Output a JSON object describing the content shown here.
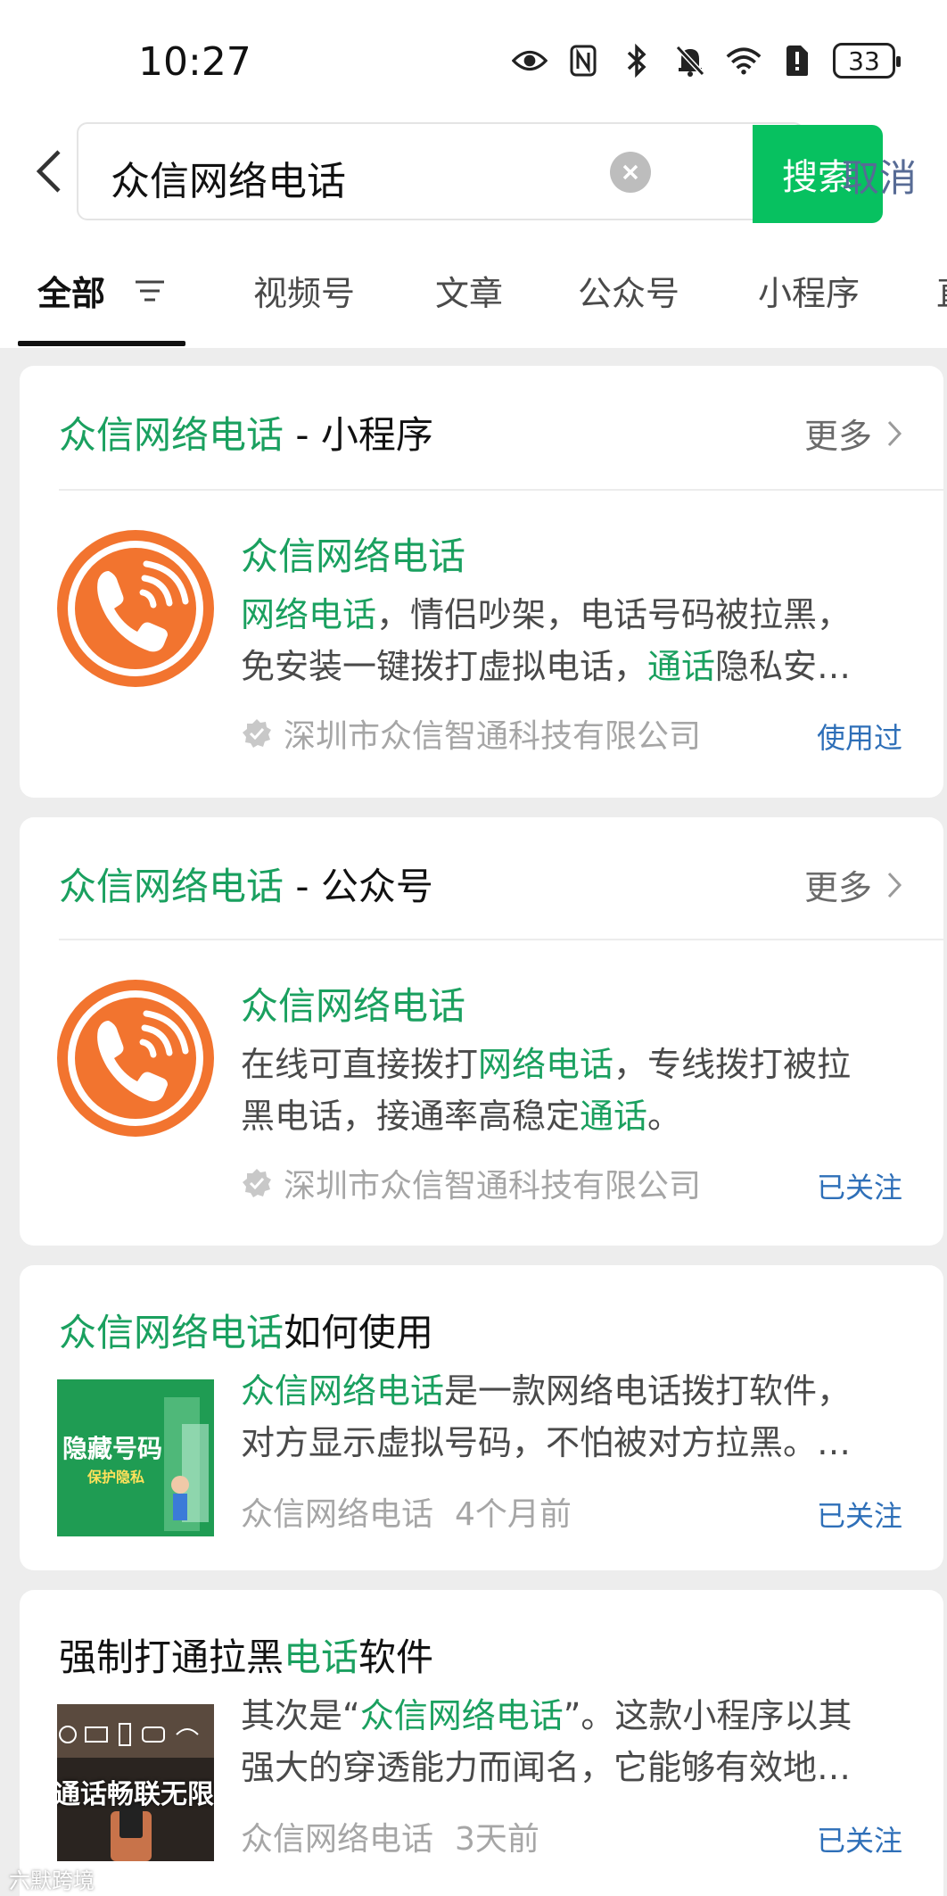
{
  "status_bar": {
    "time": "10:27",
    "battery": "33"
  },
  "search": {
    "query": "众信网络电话",
    "button_label": "搜索",
    "cancel_label": "取消"
  },
  "tabs": [
    {
      "label": "全部"
    },
    {
      "label": "视频号"
    },
    {
      "label": "文章"
    },
    {
      "label": "公众号"
    },
    {
      "label": "小程序"
    },
    {
      "label": "直"
    }
  ],
  "more_label": "更多",
  "cards": {
    "mini_program": {
      "title_highlight": "众信网络电话",
      "title_suffix": " - 小程序",
      "item_title": "众信网络电话",
      "desc_line1_hl": "网络电话",
      "desc_line1": "，情侣吵架，电话号码被拉黑，",
      "desc_line2_a": "免安装一键拨打虚拟电话，",
      "desc_line2_hl": "通话",
      "desc_line2_b": "隐私安…",
      "company": "深圳市众信智通科技有限公司",
      "action": "使用过"
    },
    "official_account": {
      "title_highlight": "众信网络电话",
      "title_suffix": " - 公众号",
      "item_title": "众信网络电话",
      "desc_line1_a": "在线可直接拨打",
      "desc_line1_hl": "网络电话",
      "desc_line1_b": "，专线拨打被拉",
      "desc_line2_a": "黑电话，接通率高稳定",
      "desc_line2_hl": "通话",
      "desc_line2_b": "。",
      "company": "深圳市众信智通科技有限公司",
      "action": "已关注"
    },
    "article1": {
      "title_hl": "众信网络电话",
      "title_rest": "如何使用",
      "desc_line1_hl": "众信网络电话",
      "desc_line1": "是一款网络电话拨打软件，",
      "desc_line2": "对方显示虚拟号码，不怕被对方拉黑。…",
      "source": "众信网络电话",
      "time": "4个月前",
      "action": "已关注",
      "thumb_text1": "隐藏号码",
      "thumb_text2": "保护隐私"
    },
    "article2": {
      "title_a": "强制打通拉黑",
      "title_hl": "电话",
      "title_b": "软件",
      "desc_line1_a": "其次是“",
      "desc_line1_hl": "众信网络电话",
      "desc_line1_b": "”。这款小程序以其",
      "desc_line2": "强大的穿透能力而闻名，它能够有效地…",
      "source": "众信网络电话",
      "time": "3天前",
      "action": "已关注",
      "thumb_text": "通话畅联无限"
    }
  },
  "watermark": "六默跨境",
  "colors": {
    "accent_green": "#07c160",
    "highlight_green": "#1aa05f",
    "link_blue": "#2e6fb8",
    "logo_orange": "#f2742f"
  }
}
